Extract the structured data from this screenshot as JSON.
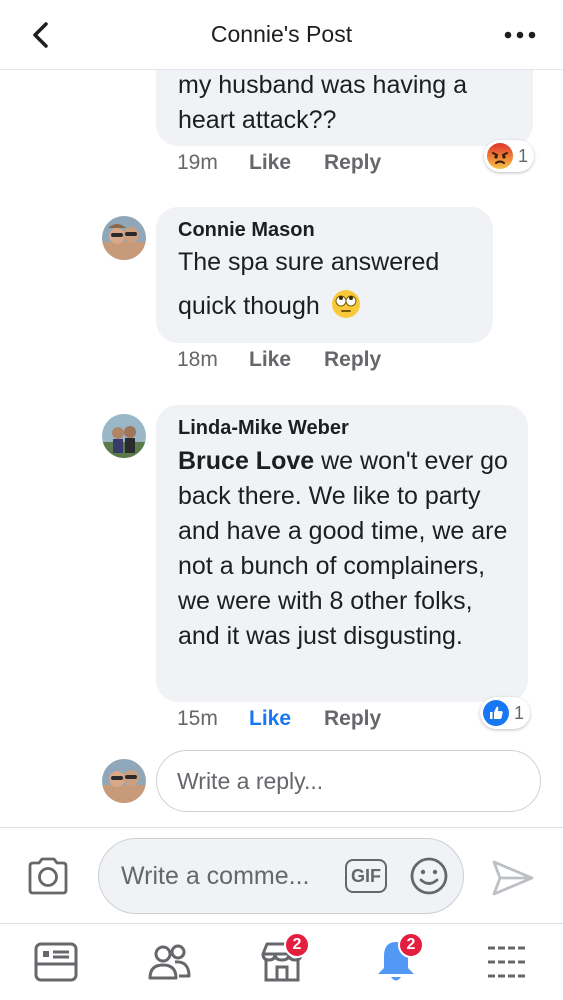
{
  "header": {
    "title": "Connie's Post",
    "back_icon": "chevron-left-icon",
    "more_icon": "more-dots-icon"
  },
  "comments": [
    {
      "text": "my husband was having a heart attack??",
      "time": "19m",
      "like_label": "Like",
      "reply_label": "Reply",
      "reaction": {
        "icon": "angry-reaction-icon",
        "count": "1",
        "color": "#e9710f"
      }
    },
    {
      "author": "Connie Mason",
      "text": "The spa sure answered quick though",
      "emoji": "eye-roll-emoji-icon",
      "time": "18m",
      "like_label": "Like",
      "reply_label": "Reply"
    },
    {
      "author": "Linda-Mike Weber",
      "tag": "Bruce Love",
      "text": " we won't ever go back there. We like to party and have a good time, we are not a bunch of complainers, we were with 8 other folks, and it was just disgusting.",
      "time": "15m",
      "like_label": "Like",
      "like_active": true,
      "reply_label": "Reply",
      "reaction": {
        "icon": "thumbs-up-reaction-icon",
        "count": "1",
        "color": "#1877f2"
      }
    }
  ],
  "reply_box": {
    "placeholder": "Write a reply..."
  },
  "composer": {
    "camera_icon": "camera-icon",
    "placeholder": "Write a comme...",
    "gif_label": "GIF",
    "emoji_icon": "smiley-icon",
    "send_icon": "send-icon"
  },
  "tabbar": {
    "tabs": [
      {
        "icon": "news-feed-icon"
      },
      {
        "icon": "friends-icon"
      },
      {
        "icon": "marketplace-icon",
        "badge": "2"
      },
      {
        "icon": "notifications-icon",
        "badge": "2"
      },
      {
        "icon": "menu-icon"
      }
    ]
  },
  "colors": {
    "accent": "#1877f2",
    "badge": "#e41e3f",
    "bubble": "#f0f2f5",
    "meta_text": "#65676b"
  }
}
